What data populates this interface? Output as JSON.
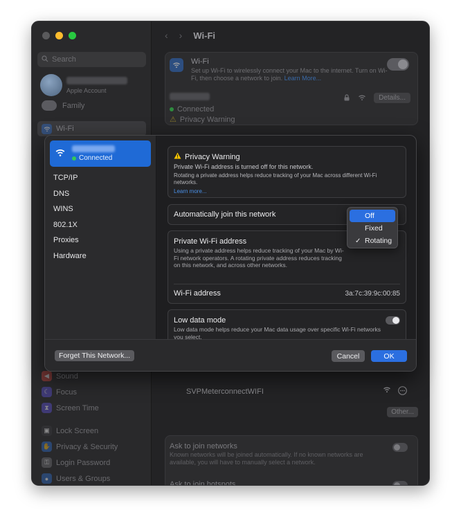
{
  "window": {
    "title": "Wi-Fi"
  },
  "sidebar": {
    "search_placeholder": "Search",
    "account_subtitle": "Apple Account",
    "family_label": "Family",
    "wifi_label": "Wi-Fi",
    "lower_items": [
      "Sound",
      "Focus",
      "Screen Time",
      "Lock Screen",
      "Privacy & Security",
      "Login Password",
      "Users & Groups"
    ]
  },
  "wifi_card": {
    "title": "Wi-Fi",
    "description": "Set up Wi-Fi to wirelessly connect your Mac to the internet. Turn on Wi-Fi, then choose a network to join.",
    "learn_more": "Learn More...",
    "status": "Connected",
    "warning": "Privacy Warning",
    "details_button": "Details..."
  },
  "known_network": {
    "name": "SVPMeterconnectWIFI"
  },
  "other_button": "Other...",
  "ask_card": {
    "ask_networks_title": "Ask to join networks",
    "ask_networks_desc": "Known networks will be joined automatically. If no known networks are available, you will have to manually select a network.",
    "ask_hotspots_title": "Ask to join hotspots"
  },
  "sheet": {
    "network_status": "Connected",
    "side_items": [
      "TCP/IP",
      "DNS",
      "WINS",
      "802.1X",
      "Proxies",
      "Hardware"
    ],
    "privacy_warning": {
      "title": "Privacy Warning",
      "line1": "Private Wi-Fi address is turned off for this network.",
      "line2": "Rotating a private address helps reduce tracking of your Mac across different Wi-Fi networks.",
      "learn_more": "Learn more..."
    },
    "auto_join_label": "Automatically join this network",
    "private_address": {
      "title": "Private Wi-Fi address",
      "description": "Using a private address helps reduce tracking of your Mac by Wi-Fi network operators. A rotating private address reduces tracking on this network, and across other networks."
    },
    "wifi_address": {
      "label": "Wi-Fi address",
      "value": "3a:7c:39:9c:00:85"
    },
    "low_data": {
      "title": "Low data mode",
      "description": "Low data mode helps reduce your Mac data usage over specific Wi-Fi networks you select."
    },
    "footer": {
      "forget": "Forget This Network...",
      "cancel": "Cancel",
      "ok": "OK"
    }
  },
  "dropdown": {
    "options": [
      {
        "label": "Off",
        "check": ""
      },
      {
        "label": "Fixed",
        "check": ""
      },
      {
        "label": "Rotating",
        "check": "✓"
      }
    ]
  },
  "colors": {
    "accent": "#2b6fe0",
    "connected_dot": "#35c759",
    "warning": "#f5c400"
  },
  "icons": {
    "wifi": "wifi-icon",
    "warning": "warning-icon",
    "lock": "lock-icon",
    "more": "more-icon",
    "check": "checkmark-icon",
    "search": "search-icon"
  }
}
